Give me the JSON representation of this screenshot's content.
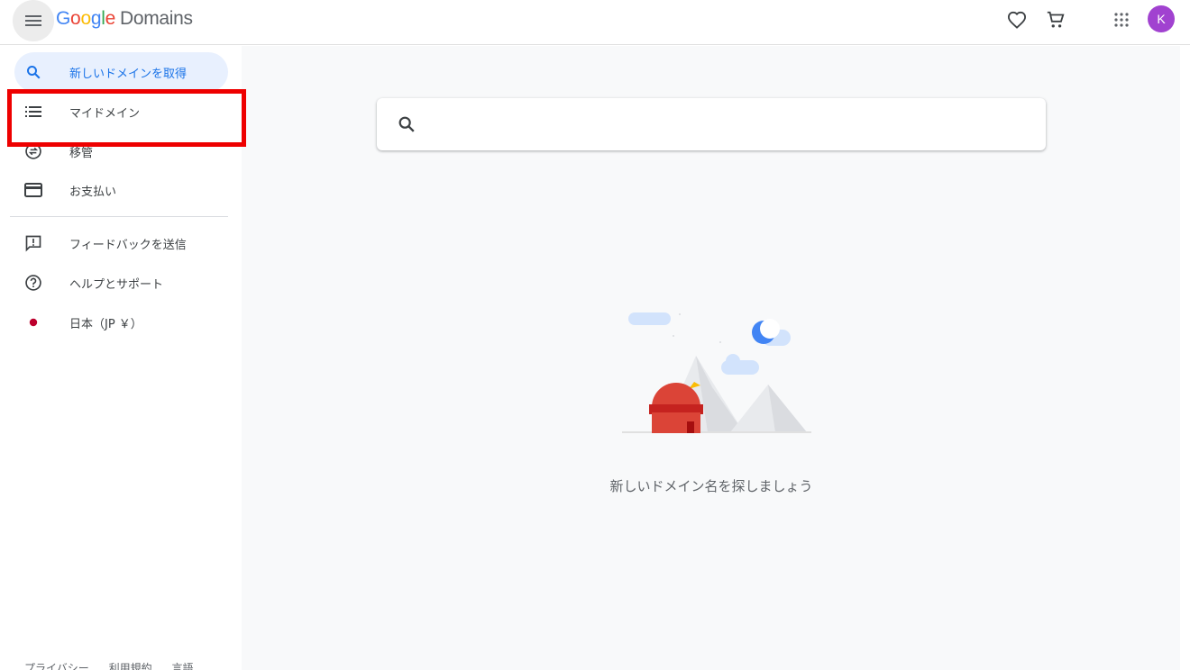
{
  "header": {
    "logo_letters": [
      "G",
      "o",
      "o",
      "g",
      "l",
      "e"
    ],
    "product_name": "Domains",
    "avatar_initial": "K"
  },
  "sidebar": {
    "items": [
      {
        "label": "新しいドメインを取得",
        "icon": "search-icon",
        "active": true
      },
      {
        "label": "マイドメイン",
        "icon": "list-icon"
      },
      {
        "label": "移管",
        "icon": "transfer-icon"
      },
      {
        "label": "お支払い",
        "icon": "credit-card-icon"
      },
      {
        "label": "フィードバックを送信",
        "icon": "feedback-icon"
      },
      {
        "label": "ヘルプとサポート",
        "icon": "help-icon"
      },
      {
        "label": "日本（JP ￥）",
        "icon": "japan-flag-icon"
      }
    ],
    "footer": [
      "プライバシー",
      "利用規約",
      "言語"
    ]
  },
  "main": {
    "search": {
      "value": "",
      "placeholder": ""
    },
    "empty_message": "新しいドメイン名を探しましょう"
  },
  "colors": {
    "accent": "#1a73e8",
    "active_bg": "#e8f0fe",
    "highlight_box": "#ee0000",
    "avatar": "#a142d0",
    "main_bg": "#f8f9fa"
  }
}
